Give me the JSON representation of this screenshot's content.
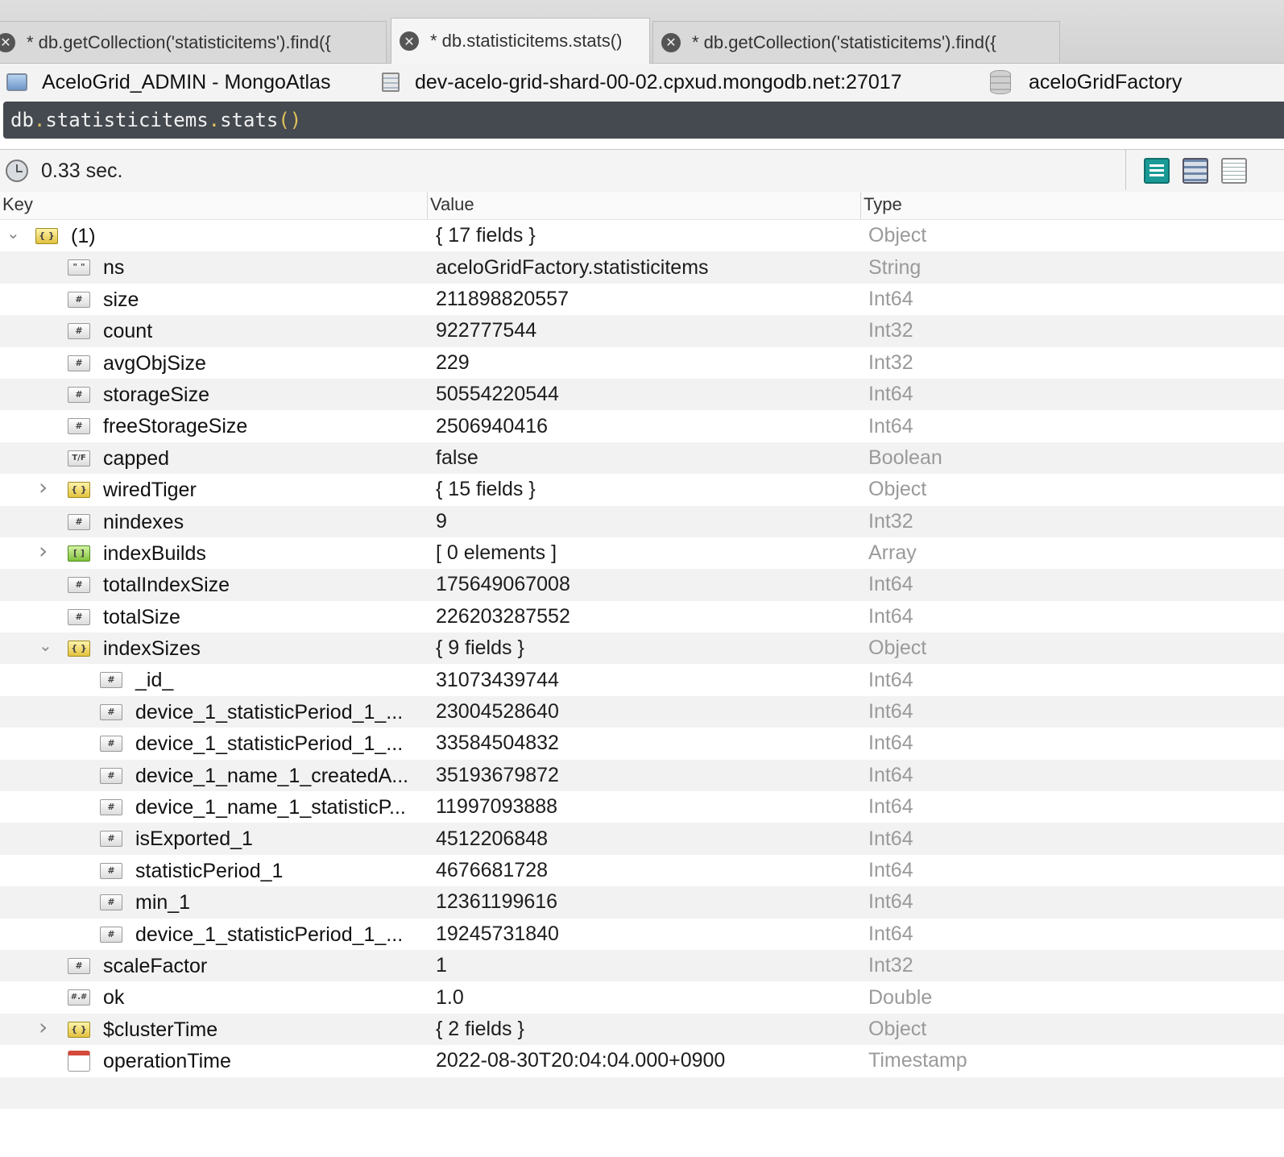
{
  "tabs": [
    {
      "label": "* db.getCollection('statisticitems').find({",
      "active": false
    },
    {
      "label": "* db.statisticitems.stats()",
      "active": true
    },
    {
      "label": "* db.getCollection('statisticitems').find({",
      "active": false
    }
  ],
  "connection": {
    "name": "AceloGrid_ADMIN - MongoAtlas",
    "server": "dev-acelo-grid-shard-00-02.cpxud.mongodb.net:27017",
    "database": "aceloGridFactory"
  },
  "query": {
    "parts": [
      "db",
      ".",
      "statisticitems",
      ".",
      "stats",
      "()"
    ]
  },
  "results": {
    "elapsed": "0.33 sec.",
    "view_buttons": [
      "tree-view-icon",
      "table-view-icon",
      "text-view-icon"
    ]
  },
  "grid": {
    "headers": [
      "Key",
      "Value",
      "Type"
    ],
    "rows": [
      {
        "depth": 0,
        "expander": "open",
        "icon": "object-icon",
        "key": "(1)",
        "value": "{ 17 fields }",
        "type": "Object"
      },
      {
        "depth": 1,
        "expander": "",
        "icon": "string-icon",
        "key": "ns",
        "value": "aceloGridFactory.statisticitems",
        "type": "String"
      },
      {
        "depth": 1,
        "expander": "",
        "icon": "number-icon",
        "key": "size",
        "value": "211898820557",
        "type": "Int64"
      },
      {
        "depth": 1,
        "expander": "",
        "icon": "number-icon",
        "key": "count",
        "value": "922777544",
        "type": "Int32"
      },
      {
        "depth": 1,
        "expander": "",
        "icon": "number-icon",
        "key": "avgObjSize",
        "value": "229",
        "type": "Int32"
      },
      {
        "depth": 1,
        "expander": "",
        "icon": "number-icon",
        "key": "storageSize",
        "value": "50554220544",
        "type": "Int64"
      },
      {
        "depth": 1,
        "expander": "",
        "icon": "number-icon",
        "key": "freeStorageSize",
        "value": "2506940416",
        "type": "Int64"
      },
      {
        "depth": 1,
        "expander": "",
        "icon": "boolean-icon",
        "key": "capped",
        "value": "false",
        "type": "Boolean"
      },
      {
        "depth": 1,
        "expander": "closed",
        "icon": "object-icon",
        "key": "wiredTiger",
        "value": "{ 15 fields }",
        "type": "Object"
      },
      {
        "depth": 1,
        "expander": "",
        "icon": "number-icon",
        "key": "nindexes",
        "value": "9",
        "type": "Int32"
      },
      {
        "depth": 1,
        "expander": "closed",
        "icon": "array-icon",
        "key": "indexBuilds",
        "value": "[ 0 elements ]",
        "type": "Array"
      },
      {
        "depth": 1,
        "expander": "",
        "icon": "number-icon",
        "key": "totalIndexSize",
        "value": "175649067008",
        "type": "Int64"
      },
      {
        "depth": 1,
        "expander": "",
        "icon": "number-icon",
        "key": "totalSize",
        "value": "226203287552",
        "type": "Int64"
      },
      {
        "depth": 1,
        "expander": "open",
        "icon": "object-icon",
        "key": "indexSizes",
        "value": "{ 9 fields }",
        "type": "Object"
      },
      {
        "depth": 2,
        "expander": "",
        "icon": "number-icon",
        "key": "_id_",
        "value": "31073439744",
        "type": "Int64"
      },
      {
        "depth": 2,
        "expander": "",
        "icon": "number-icon",
        "key": "device_1_statisticPeriod_1_...",
        "value": "23004528640",
        "type": "Int64"
      },
      {
        "depth": 2,
        "expander": "",
        "icon": "number-icon",
        "key": "device_1_statisticPeriod_1_...",
        "value": "33584504832",
        "type": "Int64"
      },
      {
        "depth": 2,
        "expander": "",
        "icon": "number-icon",
        "key": "device_1_name_1_createdA...",
        "value": "35193679872",
        "type": "Int64"
      },
      {
        "depth": 2,
        "expander": "",
        "icon": "number-icon",
        "key": "device_1_name_1_statisticP...",
        "value": "11997093888",
        "type": "Int64"
      },
      {
        "depth": 2,
        "expander": "",
        "icon": "number-icon",
        "key": "isExported_1",
        "value": "4512206848",
        "type": "Int64"
      },
      {
        "depth": 2,
        "expander": "",
        "icon": "number-icon",
        "key": "statisticPeriod_1",
        "value": "4676681728",
        "type": "Int64"
      },
      {
        "depth": 2,
        "expander": "",
        "icon": "number-icon",
        "key": "min_1",
        "value": "12361199616",
        "type": "Int64"
      },
      {
        "depth": 2,
        "expander": "",
        "icon": "number-icon",
        "key": "device_1_statisticPeriod_1_...",
        "value": "19245731840",
        "type": "Int64"
      },
      {
        "depth": 1,
        "expander": "",
        "icon": "number-icon",
        "key": "scaleFactor",
        "value": "1",
        "type": "Int32"
      },
      {
        "depth": 1,
        "expander": "",
        "icon": "double-icon",
        "key": "ok",
        "value": "1.0",
        "type": "Double"
      },
      {
        "depth": 1,
        "expander": "closed",
        "icon": "object-icon",
        "key": "$clusterTime",
        "value": "{ 2 fields }",
        "type": "Object"
      },
      {
        "depth": 1,
        "expander": "",
        "icon": "timestamp-icon",
        "key": "operationTime",
        "value": "2022-08-30T20:04:04.000+0900",
        "type": "Timestamp"
      }
    ]
  }
}
